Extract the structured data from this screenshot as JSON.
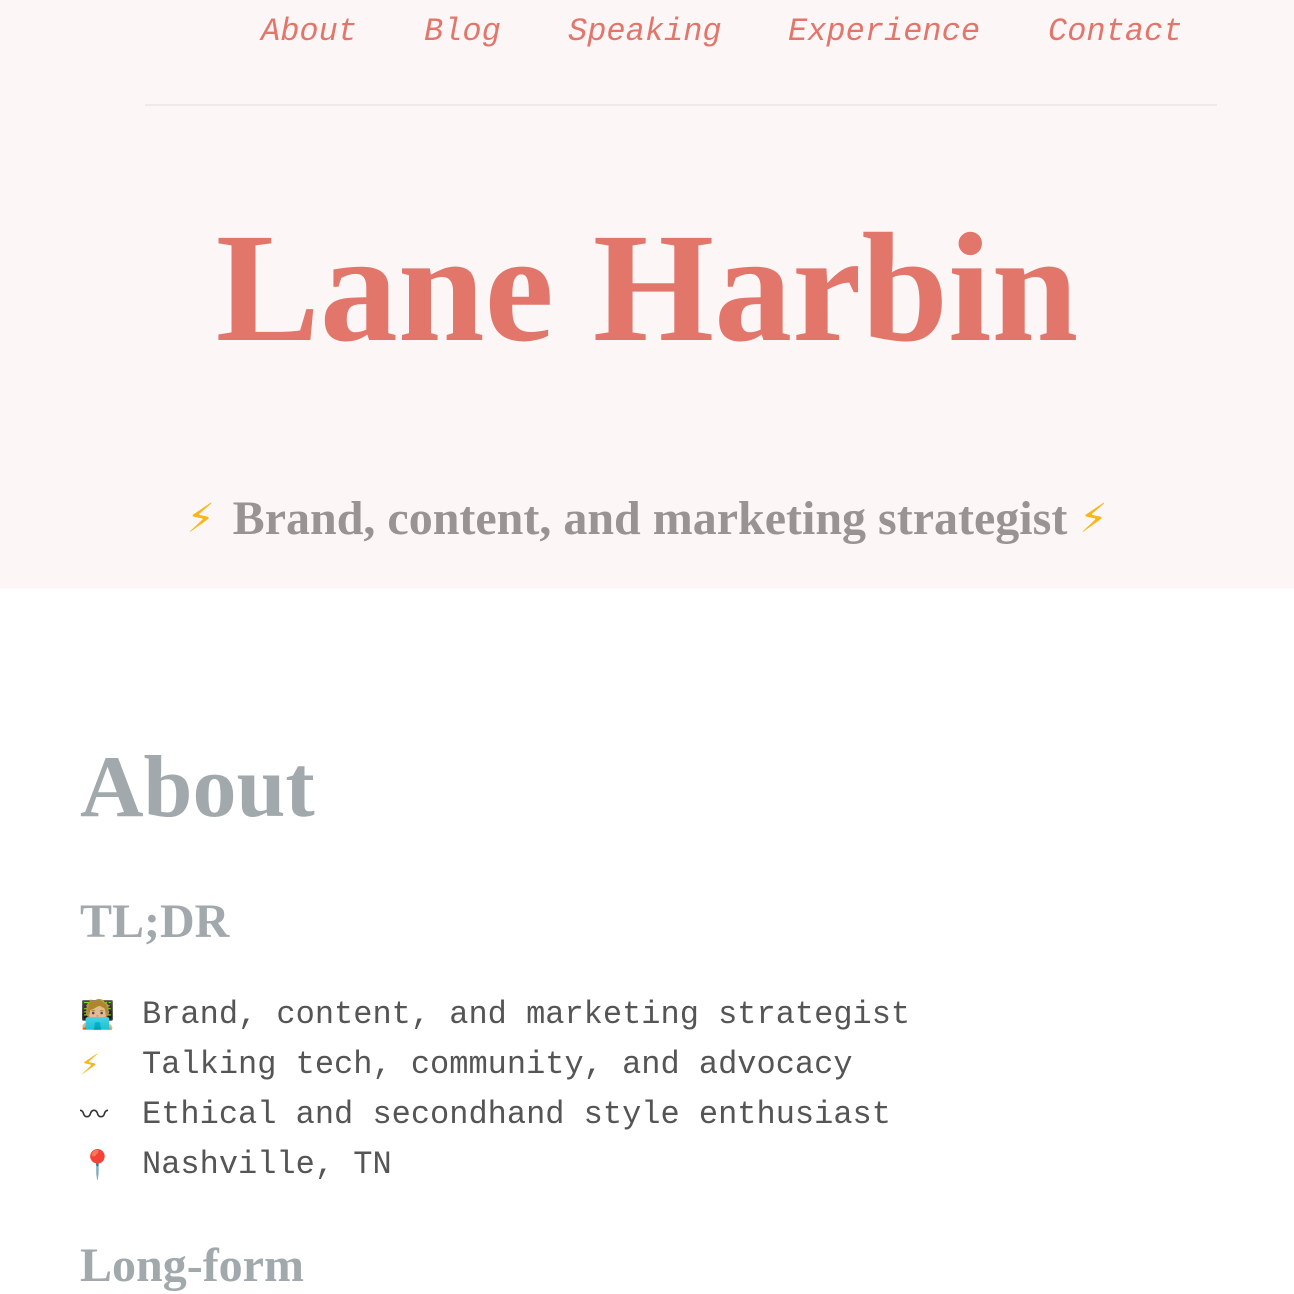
{
  "nav": {
    "items": [
      {
        "label": "About"
      },
      {
        "label": "Blog"
      },
      {
        "label": "Speaking"
      },
      {
        "label": "Experience"
      },
      {
        "label": "Contact"
      }
    ]
  },
  "hero": {
    "title": "Lane Harbin",
    "tagline": "Brand, content, and marketing strategist",
    "tagline_icon": "⚡",
    "background_color": "#fcf6f6",
    "accent_color": "#e2766b"
  },
  "about": {
    "heading": "About",
    "tldr_heading": "TL;DR",
    "tldr_items": [
      {
        "icon": "🧑🏼‍💻",
        "icon_name": "technologist-icon",
        "text": "Brand, content, and marketing strategist"
      },
      {
        "icon": "⚡",
        "icon_name": "lightning-icon",
        "text": "Talking tech, community, and advocacy"
      },
      {
        "icon": "〰",
        "icon_name": "wavy-dash-icon",
        "text": "Ethical and secondhand style enthusiast"
      },
      {
        "icon": "📍",
        "icon_name": "round-pushpin-icon",
        "text": "Nashville, TN"
      }
    ],
    "longform_heading": "Long-form",
    "heading_color": "#a2a9ad"
  }
}
